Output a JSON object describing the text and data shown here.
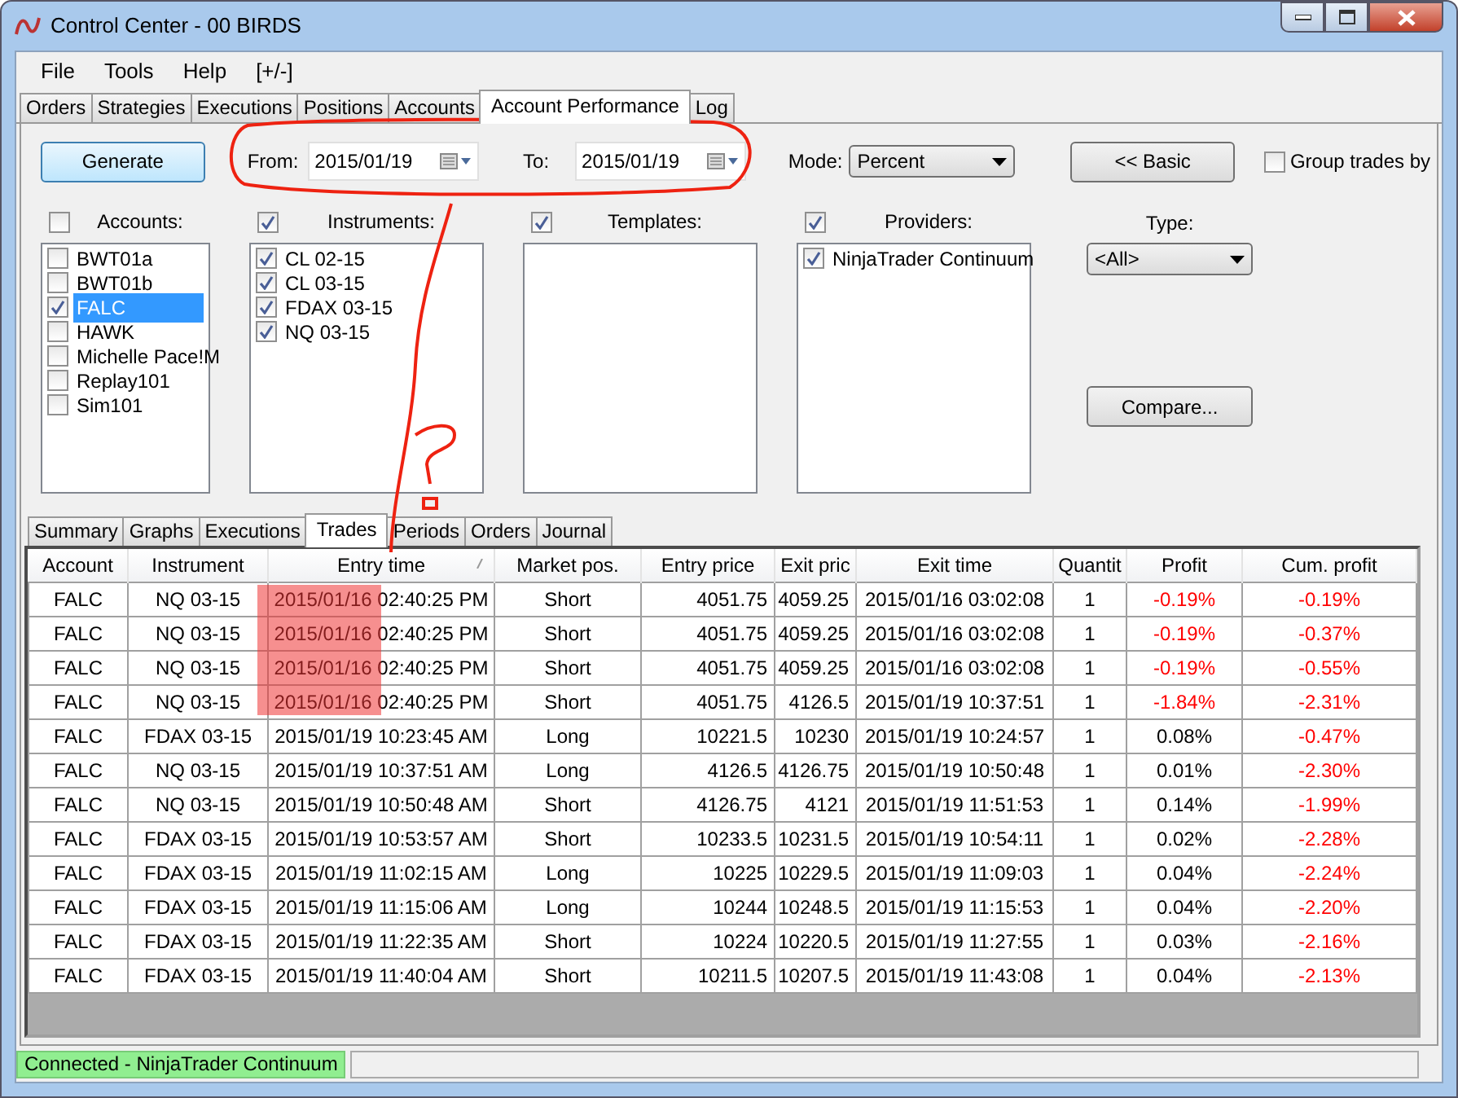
{
  "window": {
    "title": "Control Center - 00 BIRDS"
  },
  "menu": [
    "File",
    "Tools",
    "Help",
    "[+/-]"
  ],
  "tabs": [
    {
      "label": "Orders",
      "selected": false
    },
    {
      "label": "Strategies",
      "selected": false
    },
    {
      "label": "Executions",
      "selected": false
    },
    {
      "label": "Positions",
      "selected": false
    },
    {
      "label": "Accounts",
      "selected": false
    },
    {
      "label": "Account Performance",
      "selected": true
    },
    {
      "label": "Log",
      "selected": false
    }
  ],
  "toolbar": {
    "generate": "Generate",
    "from": {
      "label": "From:",
      "value": "2015/01/19"
    },
    "to": {
      "label": "To:",
      "value": "2015/01/19"
    },
    "mode": {
      "label": "Mode:",
      "value": "Percent"
    },
    "basic": "<< Basic",
    "group_trades": {
      "label": "Group trades by",
      "checked": false
    }
  },
  "filters": [
    {
      "label": "Accounts:",
      "checked": false,
      "items": [
        {
          "label": "BWT01a",
          "checked": false,
          "selected": false
        },
        {
          "label": "BWT01b",
          "checked": false,
          "selected": false
        },
        {
          "label": "FALC",
          "checked": true,
          "selected": true
        },
        {
          "label": "HAWK",
          "checked": false,
          "selected": false
        },
        {
          "label": "Michelle Pace!M",
          "checked": false,
          "selected": false
        },
        {
          "label": "Replay101",
          "checked": false,
          "selected": false
        },
        {
          "label": "Sim101",
          "checked": false,
          "selected": false
        }
      ]
    },
    {
      "label": "Instruments:",
      "checked": true,
      "items": [
        {
          "label": "CL 02-15",
          "checked": true,
          "selected": false
        },
        {
          "label": "CL 03-15",
          "checked": true,
          "selected": false
        },
        {
          "label": "FDAX 03-15",
          "checked": true,
          "selected": false
        },
        {
          "label": "NQ 03-15",
          "checked": true,
          "selected": false
        }
      ]
    },
    {
      "label": "Templates:",
      "checked": true
    },
    {
      "label": "Providers:",
      "checked": true,
      "items": [
        {
          "label": "NinjaTrader Continuum",
          "checked": true,
          "selected": false
        }
      ]
    }
  ],
  "type": {
    "label": "Type:",
    "value": "<All>"
  },
  "compare": "Compare...",
  "sub_tabs": [
    {
      "label": "Summary",
      "selected": false
    },
    {
      "label": "Graphs",
      "selected": false
    },
    {
      "label": "Executions",
      "selected": false
    },
    {
      "label": "Trades",
      "selected": true
    },
    {
      "label": "Periods",
      "selected": false
    },
    {
      "label": "Orders",
      "selected": false
    },
    {
      "label": "Journal",
      "selected": false
    }
  ],
  "table": {
    "columns": [
      "Account",
      "Instrument",
      "Entry time",
      "Market pos.",
      "Entry price",
      "Exit pric",
      "Exit time",
      "Quantit",
      "Profit",
      "Cum. profit"
    ],
    "rows": [
      {
        "cells": [
          "FALC",
          "NQ 03-15",
          "2015/01/16 02:40:25 PM",
          "Short",
          "4051.75",
          "4059.25",
          "2015/01/16 03:02:08",
          "1",
          "-0.19%",
          "-0.19%"
        ],
        "profit_loss": true,
        "cum_loss": true
      },
      {
        "cells": [
          "FALC",
          "NQ 03-15",
          "2015/01/16 02:40:25 PM",
          "Short",
          "4051.75",
          "4059.25",
          "2015/01/16 03:02:08",
          "1",
          "-0.19%",
          "-0.37%"
        ],
        "profit_loss": true,
        "cum_loss": true
      },
      {
        "cells": [
          "FALC",
          "NQ 03-15",
          "2015/01/16 02:40:25 PM",
          "Short",
          "4051.75",
          "4059.25",
          "2015/01/16 03:02:08",
          "1",
          "-0.19%",
          "-0.55%"
        ],
        "profit_loss": true,
        "cum_loss": true
      },
      {
        "cells": [
          "FALC",
          "NQ 03-15",
          "2015/01/16 02:40:25 PM",
          "Short",
          "4051.75",
          "4126.5",
          "2015/01/19 10:37:51",
          "1",
          "-1.84%",
          "-2.31%"
        ],
        "profit_loss": true,
        "cum_loss": true
      },
      {
        "cells": [
          "FALC",
          "FDAX 03-15",
          "2015/01/19 10:23:45 AM",
          "Long",
          "10221.5",
          "10230",
          "2015/01/19 10:24:57",
          "1",
          "0.08%",
          "-0.47%"
        ],
        "profit_loss": false,
        "cum_loss": true
      },
      {
        "cells": [
          "FALC",
          "NQ 03-15",
          "2015/01/19 10:37:51 AM",
          "Long",
          "4126.5",
          "4126.75",
          "2015/01/19 10:50:48",
          "1",
          "0.01%",
          "-2.30%"
        ],
        "profit_loss": false,
        "cum_loss": true
      },
      {
        "cells": [
          "FALC",
          "NQ 03-15",
          "2015/01/19 10:50:48 AM",
          "Short",
          "4126.75",
          "4121",
          "2015/01/19 11:51:53",
          "1",
          "0.14%",
          "-1.99%"
        ],
        "profit_loss": false,
        "cum_loss": true
      },
      {
        "cells": [
          "FALC",
          "FDAX 03-15",
          "2015/01/19 10:53:57 AM",
          "Short",
          "10233.5",
          "10231.5",
          "2015/01/19 10:54:11",
          "1",
          "0.02%",
          "-2.28%"
        ],
        "profit_loss": false,
        "cum_loss": true
      },
      {
        "cells": [
          "FALC",
          "FDAX 03-15",
          "2015/01/19 11:02:15 AM",
          "Long",
          "10225",
          "10229.5",
          "2015/01/19 11:09:03",
          "1",
          "0.04%",
          "-2.24%"
        ],
        "profit_loss": false,
        "cum_loss": true
      },
      {
        "cells": [
          "FALC",
          "FDAX 03-15",
          "2015/01/19 11:15:06 AM",
          "Long",
          "10244",
          "10248.5",
          "2015/01/19 11:15:53",
          "1",
          "0.04%",
          "-2.20%"
        ],
        "profit_loss": false,
        "cum_loss": true
      },
      {
        "cells": [
          "FALC",
          "FDAX 03-15",
          "2015/01/19 11:22:35 AM",
          "Short",
          "10224",
          "10220.5",
          "2015/01/19 11:27:55",
          "1",
          "0.03%",
          "-2.16%"
        ],
        "profit_loss": false,
        "cum_loss": true
      },
      {
        "cells": [
          "FALC",
          "FDAX 03-15",
          "2015/01/19 11:40:04 AM",
          "Short",
          "10211.5",
          "10207.5",
          "2015/01/19 11:43:08",
          "1",
          "0.04%",
          "-2.13%"
        ],
        "profit_loss": false,
        "cum_loss": true
      }
    ]
  },
  "status_bar": {
    "text": "Connected - NinjaTrader Continuum"
  }
}
